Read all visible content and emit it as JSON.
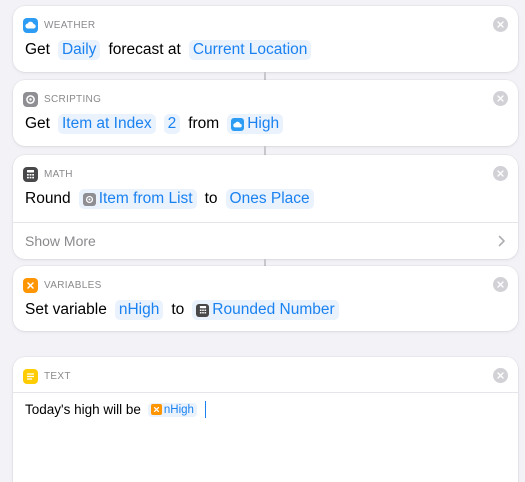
{
  "colors": {
    "accent": "#1a82f0",
    "token_bg": "#eaf2fd",
    "weather_icon": "#2c9cf5",
    "scripting_icon": "#8e8e93",
    "math_icon": "#48484a",
    "variables_icon": "#ff9500",
    "text_icon": "#ffcc00"
  },
  "actions": [
    {
      "app": "Weather",
      "icon": "cloud-icon",
      "words": {
        "w1": "Get",
        "w2": "forecast at"
      },
      "tokens": {
        "t1": "Daily",
        "t2": "Current Location"
      }
    },
    {
      "app": "Scripting",
      "icon": "gear-icon",
      "words": {
        "w1": "Get",
        "w2": "from"
      },
      "tokens": {
        "t1": "Item at Index",
        "t2": "2",
        "t3": "High"
      }
    },
    {
      "app": "Math",
      "icon": "calculator-icon",
      "words": {
        "w1": "Round",
        "w2": "to"
      },
      "tokens": {
        "t1": "Item from List",
        "t2": "Ones Place"
      },
      "show_more": "Show More"
    },
    {
      "app": "Variables",
      "icon": "variable-x-icon",
      "words": {
        "w1": "Set variable",
        "w2": "to"
      },
      "tokens": {
        "t1": "nHigh",
        "t2": "Rounded Number"
      }
    },
    {
      "app": "Text",
      "icon": "text-lines-icon",
      "body_text": "Today's high will be",
      "tokens": {
        "t1": "nHigh"
      }
    }
  ]
}
